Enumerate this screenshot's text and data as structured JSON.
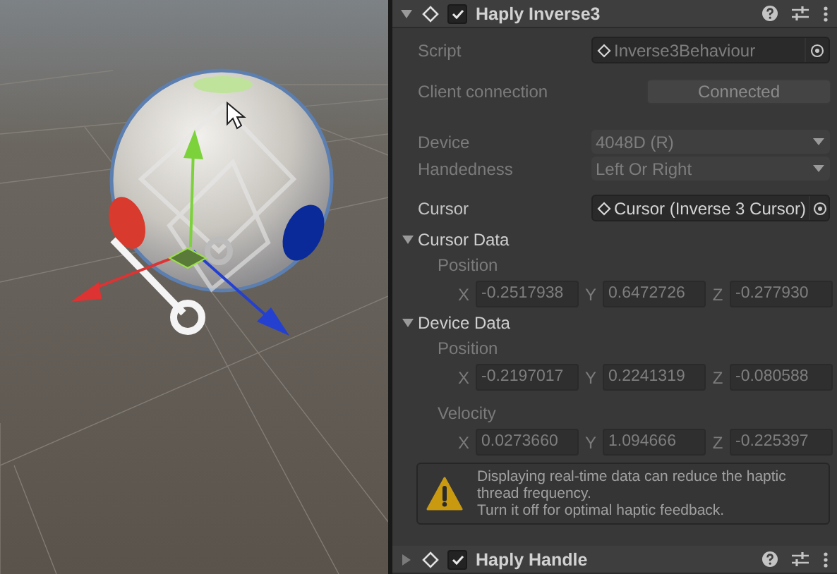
{
  "component": {
    "title": "Haply Inverse3",
    "expanded": true,
    "enabled": true,
    "fields": [
      {
        "kind": "object",
        "label": "Script",
        "value": "Inverse3Behaviour",
        "disabled": true
      },
      {
        "kind": "button",
        "label": "Client connection",
        "value": "Connected",
        "disabled": true
      },
      {
        "kind": "dropdown",
        "label": "Device",
        "value": "4048D (R)",
        "disabled": true
      },
      {
        "kind": "dropdown",
        "label": "Handedness",
        "value": "Left Or Right",
        "disabled": true
      },
      {
        "kind": "object",
        "label": "Cursor",
        "value": "Cursor (Inverse 3 Cursor)",
        "disabled": false
      }
    ],
    "sections": [
      {
        "title": "Cursor Data",
        "expanded": true,
        "vectors": [
          {
            "label": "Position",
            "disabled": true,
            "components": [
              {
                "axis": "X",
                "value": "-0.2517938"
              },
              {
                "axis": "Y",
                "value": "0.6472726"
              },
              {
                "axis": "Z",
                "value": "-0.277930"
              }
            ]
          }
        ]
      },
      {
        "title": "Device Data",
        "expanded": true,
        "vectors": [
          {
            "label": "Position",
            "disabled": true,
            "components": [
              {
                "axis": "X",
                "value": "-0.2197017"
              },
              {
                "axis": "Y",
                "value": "0.2241319"
              },
              {
                "axis": "Z",
                "value": "-0.080588"
              }
            ]
          },
          {
            "label": "Velocity",
            "disabled": true,
            "components": [
              {
                "axis": "X",
                "value": "0.0273660"
              },
              {
                "axis": "Y",
                "value": "1.094666"
              },
              {
                "axis": "Z",
                "value": "-0.225397"
              }
            ]
          }
        ]
      }
    ],
    "warning": {
      "text": "Displaying real-time data can reduce the haptic\nthread frequency.\nTurn it off for optimal haptic feedback."
    }
  },
  "next_component": {
    "title": "Haply Handle",
    "expanded": false,
    "enabled": true
  }
}
